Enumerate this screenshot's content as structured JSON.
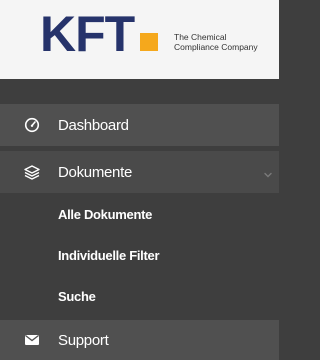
{
  "logo": {
    "wordmark": "KFT",
    "tagline_line1": "The Chemical",
    "tagline_line2": "Compliance Company",
    "accent_color": "#f5a81c",
    "brand_color": "#26336b"
  },
  "sidebar": {
    "items": [
      {
        "label": "Dashboard",
        "icon": "gauge-icon"
      },
      {
        "label": "Dokumente",
        "icon": "layers-icon",
        "expanded": true,
        "children": [
          {
            "label": "Alle Dokumente"
          },
          {
            "label": "Individuelle Filter"
          },
          {
            "label": "Suche"
          }
        ]
      },
      {
        "label": "Support",
        "icon": "envelope-icon"
      }
    ]
  }
}
